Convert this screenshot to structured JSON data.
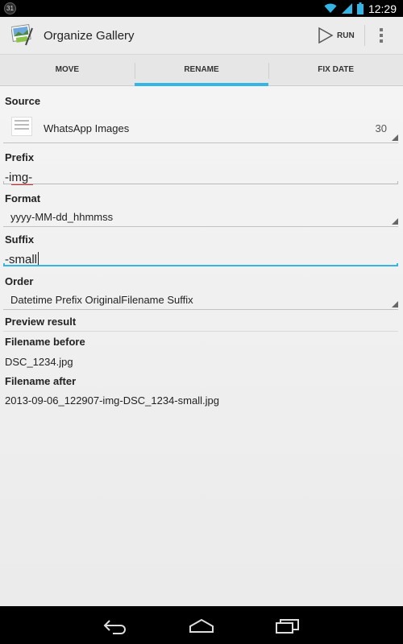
{
  "status_bar": {
    "notification_icon": "badge-31-icon",
    "wifi_icon": "wifi-icon",
    "signal_icon": "signal-icon",
    "battery_icon": "battery-icon",
    "time": "12:29"
  },
  "action_bar": {
    "app_icon": "gallery-app-icon",
    "title": "Organize Gallery",
    "run_label": "RUN",
    "run_icon": "play-icon",
    "overflow_icon": "overflow-menu-icon"
  },
  "tabs": [
    {
      "label": "MOVE",
      "active": false
    },
    {
      "label": "RENAME",
      "active": true
    },
    {
      "label": "FIX DATE",
      "active": false
    }
  ],
  "accent_color": "#33b5e5",
  "form": {
    "source_label": "Source",
    "source_value": "WhatsApp Images",
    "source_count": "30",
    "prefix_label": "Prefix",
    "prefix_value": "-img-",
    "format_label": "Format",
    "format_value": "yyyy-MM-dd_hhmmss",
    "suffix_label": "Suffix",
    "suffix_value": "-small",
    "order_label": "Order",
    "order_value": "Datetime Prefix OriginalFilename Suffix",
    "preview_label": "Preview result",
    "before_label": "Filename before",
    "before_value": "DSC_1234.jpg",
    "after_label": "Filename after",
    "after_value": "2013-09-06_122907-img-DSC_1234-small.jpg"
  },
  "nav_bar": {
    "back_icon": "back-icon",
    "home_icon": "home-icon",
    "recents_icon": "recent-apps-icon"
  }
}
